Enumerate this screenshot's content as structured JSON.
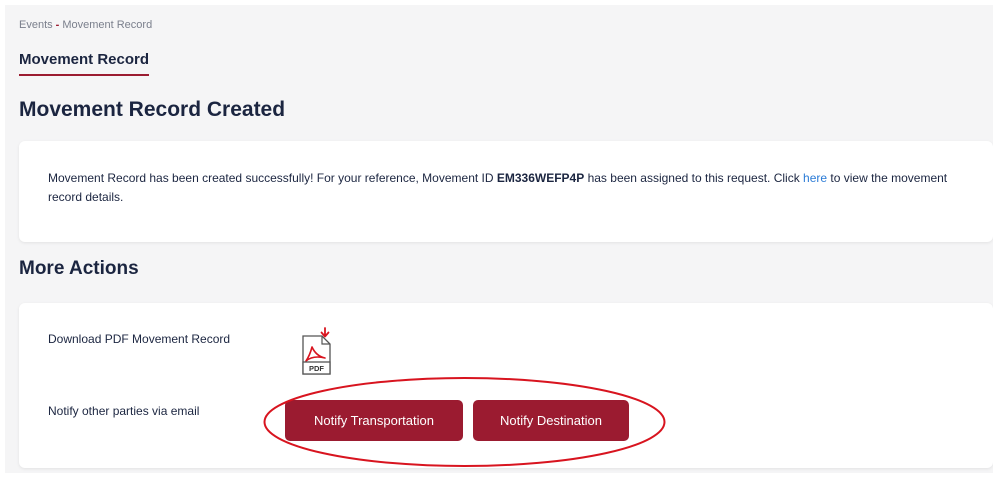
{
  "breadcrumb": {
    "parent": "Events",
    "separator": "-",
    "current": "Movement Record"
  },
  "tab": {
    "label": "Movement Record"
  },
  "title": "Movement Record Created",
  "confirmation": {
    "text_before_id": "Movement Record has been created successfully! For your reference, Movement ID ",
    "movement_id": "EM336WEFP4P",
    "text_after_id": " has been assigned to this request. Click ",
    "link_text": "here",
    "text_after_link": " to view the movement record details."
  },
  "more_actions": {
    "heading": "More Actions",
    "download_label": "Download PDF Movement Record",
    "pdf_icon_text": "PDF",
    "notify_label": "Notify other parties via email",
    "notify_transportation": "Notify Transportation",
    "notify_destination": "Notify Destination"
  },
  "colors": {
    "accent": "#9b1b30",
    "link": "#2b7bd6",
    "heading": "#1b2540",
    "annotation": "#d8141f"
  }
}
